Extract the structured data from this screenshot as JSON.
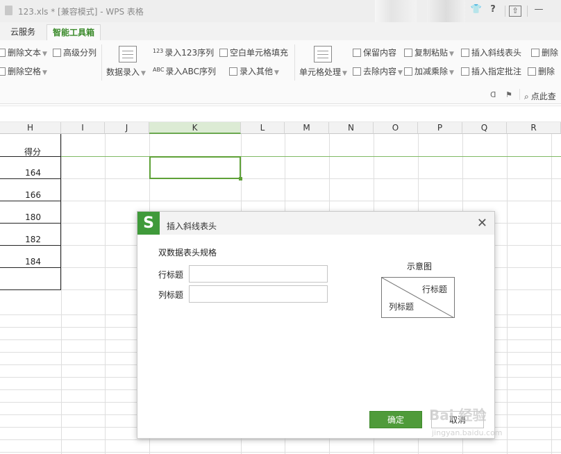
{
  "window": {
    "title": "123.xls * [兼容模式] - WPS 表格",
    "controls": [
      "👕",
      "?",
      "⇧",
      "—"
    ]
  },
  "tabs": [
    {
      "label": "云服务",
      "active": false
    },
    {
      "label": "智能工具箱",
      "active": true
    }
  ],
  "ribbon": {
    "delete_text": "删除文本",
    "advanced_split": "高级分列",
    "delete_space": "删除空格",
    "data_entry": "数据录入",
    "entry_123": "录入123序列",
    "blank_fill": "空白单元格填充",
    "entry_abc": "录入ABC序列",
    "entry_other": "录入其他",
    "cell_process": "单元格处理",
    "keep_content": "保留内容",
    "copy_paste": "复制粘贴",
    "insert_diag_header": "插入斜线表头",
    "delete_trunc": "删除",
    "remove_content": "去除内容",
    "add_sub_mul_div": "加减乘除",
    "insert_comment": "插入指定批注",
    "delete_trunc2": "删除",
    "search_label": "点此查"
  },
  "grid": {
    "columns": [
      "H",
      "I",
      "J",
      "K",
      "L",
      "M",
      "N",
      "O",
      "P",
      "Q",
      "R"
    ],
    "selected_column": "K",
    "h_header": "得分",
    "h_values": [
      "164",
      "166",
      "180",
      "182",
      "184"
    ]
  },
  "dialog": {
    "title": "插入斜线表头",
    "logo": "S",
    "section_title": "双数据表头规格",
    "row_title_label": "行标题",
    "row_title_value": "",
    "col_title_label": "列标题",
    "col_title_value": "",
    "preview_title": "示意图",
    "preview_row": "行标题",
    "preview_col": "列标题",
    "ok_label": "确定",
    "cancel_label": "取消"
  },
  "watermark": {
    "brand": "Bai 经验",
    "url": "jingyan.baidu.com"
  }
}
